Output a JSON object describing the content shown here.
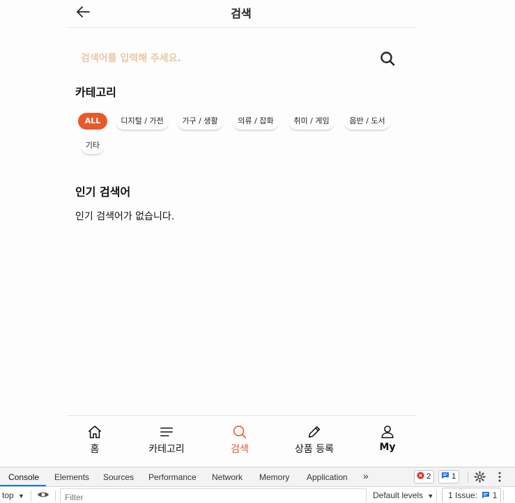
{
  "header": {
    "title": "검색",
    "back_icon": "arrow-left-icon"
  },
  "search": {
    "placeholder": "검색어를 입력해 주세요.",
    "value": "",
    "icon": "search-icon"
  },
  "category": {
    "title": "카테고리",
    "chips": [
      {
        "label": "ALL",
        "active": true
      },
      {
        "label": "디지털 / 가전",
        "active": false
      },
      {
        "label": "가구 / 생활",
        "active": false
      },
      {
        "label": "의류 / 잡화",
        "active": false
      },
      {
        "label": "취미 / 게임",
        "active": false
      },
      {
        "label": "음반 / 도서",
        "active": false
      },
      {
        "label": "기타",
        "active": false
      }
    ]
  },
  "popular": {
    "title": "인기 검색어",
    "empty_message": "인기 검색어가 없습니다."
  },
  "bottom_nav": {
    "items": [
      {
        "label": "홈",
        "icon": "home-icon",
        "active": false
      },
      {
        "label": "카테고리",
        "icon": "menu-icon",
        "active": false
      },
      {
        "label": "검색",
        "icon": "search-icon",
        "active": true
      },
      {
        "label": "상품 등록",
        "icon": "pencil-icon",
        "active": false
      },
      {
        "label": "My",
        "icon": "user-icon",
        "active": false
      }
    ]
  },
  "colors": {
    "accent": "#e8592a",
    "placeholder": "#e8c9a6",
    "text": "#111111",
    "divider": "#e4e4e4"
  },
  "devtools": {
    "tabs": [
      "Console",
      "Elements",
      "Sources",
      "Performance",
      "Network",
      "Memory",
      "Application"
    ],
    "active_tab": "Console",
    "more": "»",
    "error_count": "2",
    "message_count": "1",
    "context": "top",
    "filter_placeholder": "Filter",
    "levels": "Default levels",
    "issues_label": "1 Issue:",
    "issues_count": "1"
  }
}
